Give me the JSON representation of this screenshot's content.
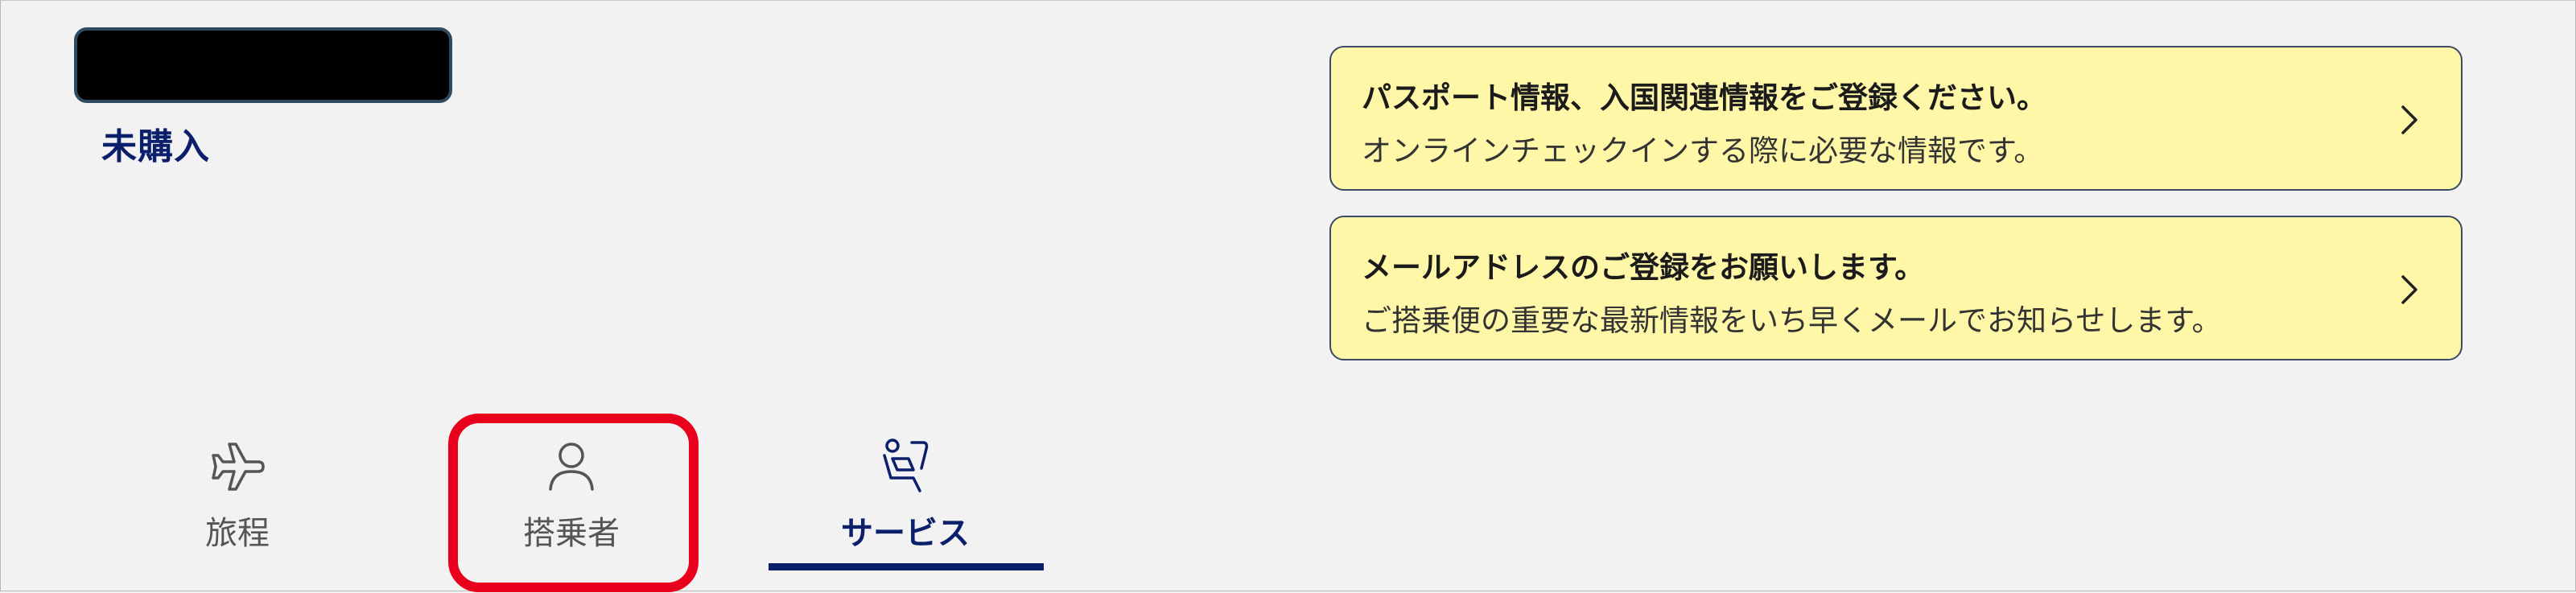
{
  "status_label": "未購入",
  "notices": [
    {
      "title": "パスポート情報、入国関連情報をご登録ください。",
      "description": "オンラインチェックインする際に必要な情報です。"
    },
    {
      "title": "メールアドレスのご登録をお願いします。",
      "description": "ご搭乗便の重要な最新情報をいち早くメールでお知らせします。"
    }
  ],
  "tabs": [
    {
      "label": "旅程",
      "icon": "airplane-icon"
    },
    {
      "label": "搭乗者",
      "icon": "person-icon"
    },
    {
      "label": "サービス",
      "icon": "seat-icon",
      "active": true
    }
  ],
  "colors": {
    "accent": "#0c1f6b",
    "notice_bg": "#fff7a8",
    "highlight": "#e8001c",
    "background": "#f2f2f2"
  }
}
